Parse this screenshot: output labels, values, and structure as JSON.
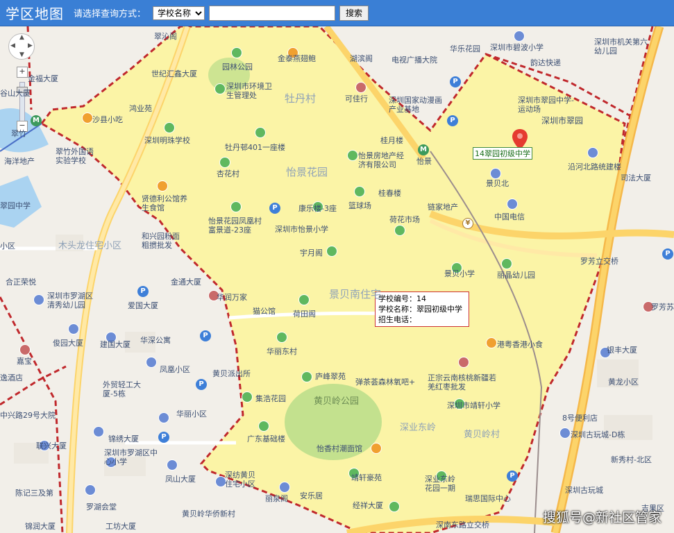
{
  "header": {
    "title": "学区地图",
    "query_label": "请选择查询方式：",
    "query_select_value": "学校名称",
    "query_input_value": "",
    "search_button": "搜索"
  },
  "map_controls": {
    "zoom_in": "+",
    "zoom_out": "−"
  },
  "marker": {
    "label": "14翠园初级中学",
    "color": "#e53b30"
  },
  "info_window": {
    "line1": "学校编号：14",
    "line2": "学校名称：翠园初级中学",
    "line3": "招生电话："
  },
  "colors": {
    "zone_fill": "#fdf59a",
    "boundary": "#c0282c",
    "header": "#3a7fd5"
  },
  "watermark": "搜狐号@新社区管家",
  "labels": {
    "l1": "翠沁阁",
    "l2": "金福大厦",
    "l3": "谷山大厦",
    "l4": "翠竹",
    "l5": "海洋地产",
    "l6": "翠竹外国语实验学校",
    "l7": "世纪汇鑫大厦",
    "l8": "园林公园",
    "l9": "金泰燕翅鲍",
    "l10": "深圳市环境卫生管理处",
    "l11": "鸿业苑",
    "l12": "沙县小吃",
    "l13": "深圳明珠学校",
    "l14": "牡丹村",
    "l15": "可佳行",
    "l16": "湖滨阁",
    "l17": "电视广播大院",
    "l18": "华乐花园",
    "l19": "深圳市碧波小学",
    "l20": "深圳市机关第六幼儿园",
    "l21": "韵达快递",
    "l22": "深圳国家动漫画产业基地",
    "l23": "深圳市翠园中学-运动场",
    "l24": "深圳市翠园",
    "l25": "牡丹邨401一座楼",
    "l26": "怡景房地产经济有限公司",
    "l27": "桂月楼",
    "l28": "怡景",
    "l29": "沿河北路统建楼",
    "l30": "杏花村",
    "l31": "怡景花园",
    "l32": "景贝北",
    "l33": "司法大厦",
    "l34": "翠园中学",
    "l35": "贤德利公馆养生食馆",
    "l36": "康乐楼-3座",
    "l37": "篮球场",
    "l38": "桂春楼",
    "l39": "链家地产",
    "l40": "怡景花园凤凰村富景道-23座",
    "l41": "深圳市怡景小学",
    "l42": "荷花市场",
    "l43": "中国电信",
    "l44": "和兴园粉面粗掼批发",
    "l45": "木头龙住宅小区",
    "l46": "宇月阁",
    "l47": "景贝小学",
    "l48": "丽晶幼儿园",
    "l49": "罗芳立交桥",
    "l50": "合正荣悦",
    "l51": "金通大厦",
    "l52": "华润万家",
    "l53": "深圳市罗湖区清秀幼儿园",
    "l54": "爱国大厦",
    "l55": "猫公馆",
    "l56": "荷田阁",
    "l57": "景贝南住宅",
    "l58": "罗芳苏",
    "l59": "港粤香港小食",
    "l60": "银丰大厦",
    "l61": "俊园大厦",
    "l62": "建国大厦",
    "l63": "华深公寓",
    "l64": "华丽东村",
    "l65": "嘉宝",
    "l66": "凤凰小区",
    "l67": "黄贝派出所",
    "l68": "庐峰翠苑",
    "l69": "弹茶荟森林氧吧+",
    "l70": "正宗云南核桃新疆若羌红枣批发",
    "l71": "外贸轻工大厦-5栋",
    "l72": "集浩花园",
    "l73": "黄贝岭公园",
    "l74": "深圳市靖轩小学",
    "l75": "黄龙小区",
    "l76": "中兴路29号大院",
    "l77": "华丽小区",
    "l78": "深业东岭",
    "l79": "黄贝岭村",
    "l80": "8号便利店",
    "l81": "锦绣大厦",
    "l82": "深圳古玩城-D栋",
    "l83": "联兴大厦",
    "l84": "深圳市罗湖区中心小学",
    "l85": "广东基础楼",
    "l86": "怡香村潮面馆",
    "l87": "新秀村-北区",
    "l88": "凤山大厦",
    "l89": "深纺黄贝住宅小区",
    "l90": "靖轩豪苑",
    "l91": "深业东岭花园一期",
    "l92": "深圳古玩城",
    "l93": "陈记三及第",
    "l94": "罗湖会堂",
    "l95": "丽泉阁",
    "l96": "安乐居",
    "l97": "瑞思国际中心",
    "l98": "吉果区",
    "l99": "黄贝岭华侨新村",
    "l100": "经祥大厦",
    "l101": "深南东路立交桥",
    "l102": "工坊大厦",
    "l103": "锦润大厦",
    "l104": "小区",
    "l105": "逸酒店"
  }
}
